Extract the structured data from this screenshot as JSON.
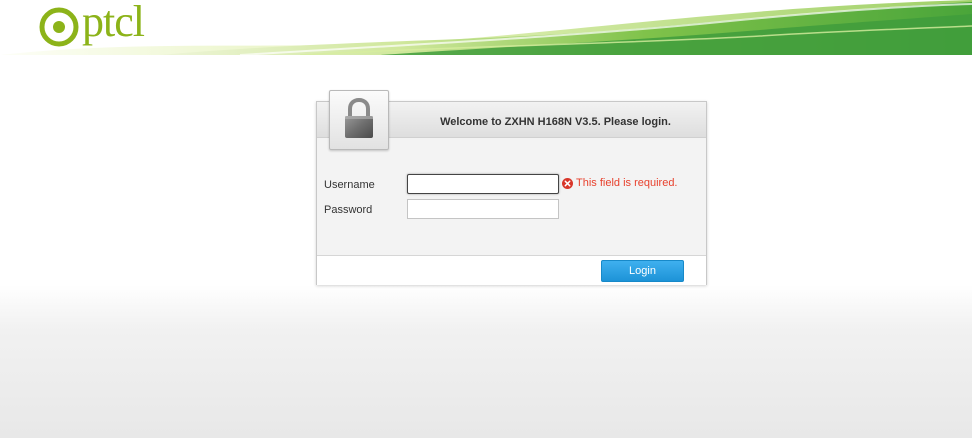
{
  "brand": {
    "logo_text": "ptcl",
    "logo_icon": "ptcl-ring-logo-icon",
    "color": "#8cb319"
  },
  "login": {
    "title": "Welcome to ZXHN H168N V3.5. Please login.",
    "lock_icon": "padlock-icon",
    "username_label": "Username",
    "username_value": "",
    "password_label": "Password",
    "password_value": "",
    "error_icon": "error-circle-icon",
    "error_text": "This field is required.",
    "error_color": "#e8412d",
    "button_label": "Login",
    "button_color": "#1d93d7"
  }
}
